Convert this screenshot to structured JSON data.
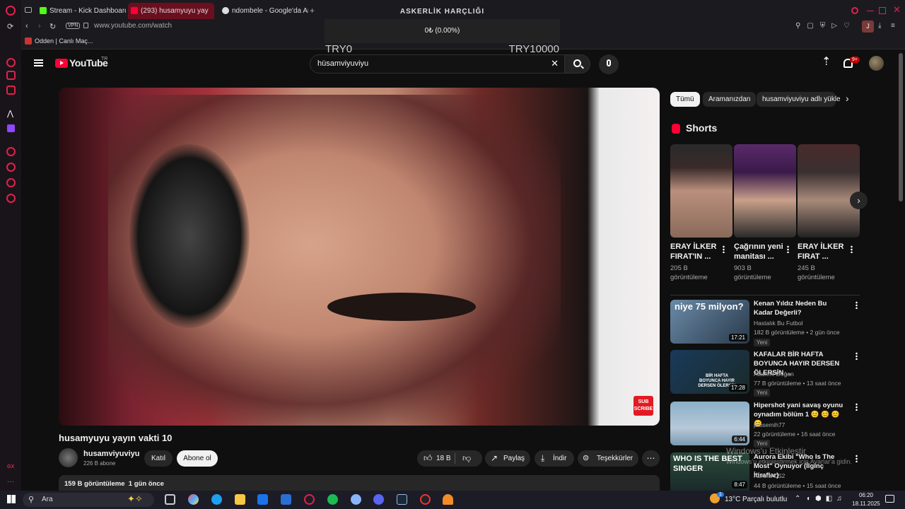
{
  "browser": {
    "tabs": [
      {
        "label": "Stream - Kick Dashboard",
        "color": "#53fc18"
      },
      {
        "label": "(293) husamyuyu yay",
        "color": "#ff0033"
      },
      {
        "label": "ndombele - Google'da Ar",
        "color": "#cccccc"
      }
    ],
    "vpn": "VPN",
    "url": "www.youtube.com/watch",
    "bookmark": "Odden | Canlı Maç...",
    "profile_letter": "J"
  },
  "overlay": {
    "title": "ASKERLİK HARÇLIĞI",
    "amount": "0₺ (0.00%)",
    "min": "TRY0",
    "max": "TRY10000"
  },
  "youtube": {
    "logo": "YouTube",
    "country": "TR",
    "search_value": "hüsamviyuviyu",
    "notif_count": "9+"
  },
  "video": {
    "sub_badge": "SUB SCRIBE",
    "title": "husamyuyu yayın vakti 10",
    "channel": "husamviyuviyu",
    "subs": "226 B abone",
    "join": "Katıl",
    "subscribe": "Abone ol",
    "likes": "18 B",
    "share": "Paylaş",
    "download": "İndir",
    "thanks": "Teşekkürler",
    "views_line": "159 B görüntüleme  1 gün önce"
  },
  "chips": [
    "Tümü",
    "Aramanızdan",
    "husamviyuviyu adlı yükle"
  ],
  "shorts": {
    "heading": "Shorts",
    "items": [
      {
        "title": "ERAY İLKER FIRAT'IN ...",
        "views": "205 B görüntüleme"
      },
      {
        "title": "Çağrının yeni manitası ...",
        "views": "903 B görüntüleme"
      },
      {
        "title": "ERAY İLKER FIRAT ...",
        "views": "245 B görüntüleme"
      }
    ]
  },
  "recs": [
    {
      "title": "Kenan Yıldız Neden Bu Kadar Değerli?",
      "channel": "Hastalık Bu Futbol",
      "meta": "182 B görüntüleme • 2 gün önce",
      "duration": "17:21",
      "new": "Yeni",
      "thumb_text": "niye 75 milyon?"
    },
    {
      "title": "KAFALAR BİR HAFTA BOYUNCA HAYIR DERSEN ÖLERSİN ...",
      "channel": "Ataberk Doğan",
      "meta": "77 B görüntüleme • 13 saat önce",
      "duration": "17:28",
      "new": "Yeni",
      "thumb_text": "BİR HAFTA BOYUNCA HAYIR DERSEN ÖLERSİN"
    },
    {
      "title": "Hipershot yani savaş oyunu oynadım bölüm 1 😊 😊 😊 😊",
      "channel": "prosemih77",
      "meta": "22 görüntüleme • 16 saat önce",
      "duration": "6:44",
      "new": "Yeni",
      "thumb_text": ""
    },
    {
      "title": "Aurora Ekibi \"Who Is The Most\" Oynuyor (İlginç İtiraflar)",
      "channel": "Aurora CS2",
      "meta": "44 B görüntüleme • 15 saat önce",
      "duration": "8:47",
      "new": "",
      "thumb_text": "WHO IS THE BEST SINGER"
    }
  ],
  "watermark": {
    "line1": "Windows'u Etkinleştir",
    "line2": "Windows'u etkinleştirmek için Ayarlar'a gidin."
  },
  "taskbar": {
    "search": "Ara",
    "temp": "13°C",
    "weather": "Parçalı bulutlu",
    "time": "06:20",
    "date": "18.11.2025",
    "weather_badge": "1"
  }
}
